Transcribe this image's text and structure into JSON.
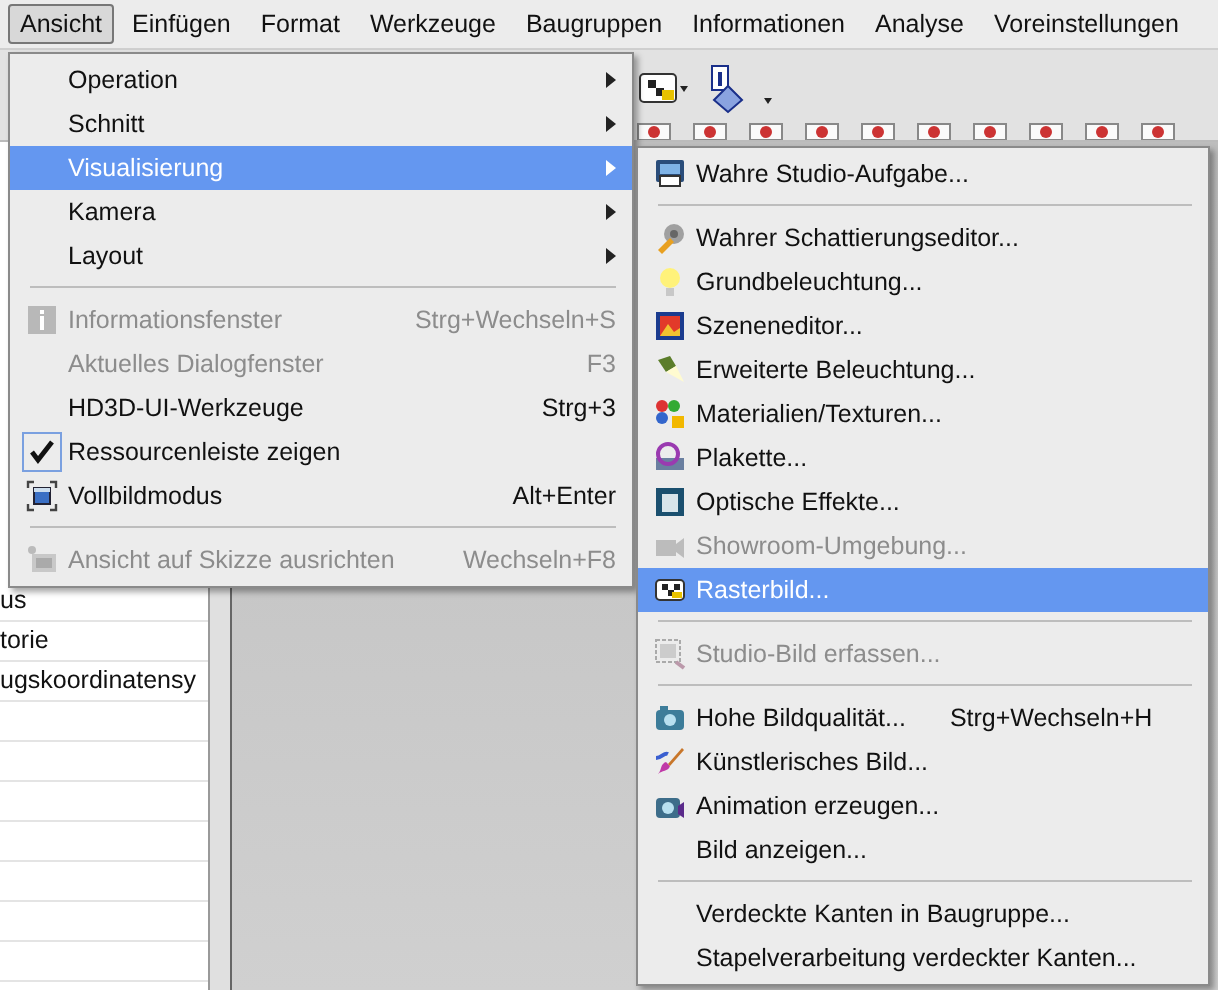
{
  "menubar": [
    {
      "label": "Ansicht",
      "selected": true
    },
    {
      "label": "Einfügen",
      "selected": false
    },
    {
      "label": "Format",
      "selected": false
    },
    {
      "label": "Werkzeuge",
      "selected": false
    },
    {
      "label": "Baugruppen",
      "selected": false
    },
    {
      "label": "Informationen",
      "selected": false
    },
    {
      "label": "Analyse",
      "selected": false
    },
    {
      "label": "Voreinstellungen",
      "selected": false
    }
  ],
  "view_menu": [
    {
      "kind": "submenu",
      "label": "Operation",
      "selected": false
    },
    {
      "kind": "submenu",
      "label": "Schnitt",
      "selected": false
    },
    {
      "kind": "submenu",
      "label": "Visualisierung",
      "selected": true
    },
    {
      "kind": "submenu",
      "label": "Kamera",
      "selected": false
    },
    {
      "kind": "submenu",
      "label": "Layout",
      "selected": false
    },
    {
      "kind": "separator"
    },
    {
      "kind": "command",
      "label": "Informationsfenster",
      "shortcut": "Strg+Wechseln+S",
      "disabled": true,
      "checked": false
    },
    {
      "kind": "command",
      "label": "Aktuelles Dialogfenster",
      "shortcut": "F3",
      "disabled": true,
      "checked": false
    },
    {
      "kind": "command",
      "label": "HD3D-UI-Werkzeuge",
      "shortcut": "Strg+3",
      "disabled": false,
      "checked": false
    },
    {
      "kind": "command",
      "label": "Ressourcenleiste zeigen",
      "disabled": false,
      "checked": true
    },
    {
      "kind": "command",
      "label": "Vollbildmodus",
      "shortcut": "Alt+Enter",
      "disabled": false,
      "checked": false
    },
    {
      "kind": "separator"
    },
    {
      "kind": "command",
      "label": "Ansicht auf Skizze ausrichten",
      "shortcut": "Wechseln+F8",
      "disabled": true,
      "checked": false
    }
  ],
  "visualization_submenu": [
    {
      "label": "Wahre Studio-Aufgabe...",
      "disabled": false,
      "selected": false
    },
    {
      "kind": "separator"
    },
    {
      "label": "Wahrer Schattierungseditor...",
      "disabled": false,
      "selected": false
    },
    {
      "label": "Grundbeleuchtung...",
      "disabled": false,
      "selected": false
    },
    {
      "label": "Szeneneditor...",
      "disabled": false,
      "selected": false
    },
    {
      "label": "Erweiterte Beleuchtung...",
      "disabled": false,
      "selected": false
    },
    {
      "label": "Materialien/Texturen...",
      "disabled": false,
      "selected": false
    },
    {
      "label": "Plakette...",
      "disabled": false,
      "selected": false
    },
    {
      "label": "Optische Effekte...",
      "disabled": false,
      "selected": false
    },
    {
      "label": "Showroom-Umgebung...",
      "disabled": true,
      "selected": false
    },
    {
      "label": "Rasterbild...",
      "disabled": false,
      "selected": true
    },
    {
      "kind": "separator"
    },
    {
      "label": "Studio-Bild erfassen...",
      "disabled": true,
      "selected": false
    },
    {
      "kind": "separator"
    },
    {
      "label": "Hohe Bildqualität...",
      "shortcut": "Strg+Wechseln+H",
      "disabled": false,
      "selected": false
    },
    {
      "label": "Künstlerisches Bild...",
      "disabled": false,
      "selected": false
    },
    {
      "label": "Animation erzeugen...",
      "disabled": false,
      "selected": false
    },
    {
      "label": "Bild anzeigen...",
      "disabled": false,
      "selected": false
    },
    {
      "kind": "separator"
    },
    {
      "label": "Verdeckte Kanten in Baugruppe...",
      "disabled": false,
      "selected": false
    },
    {
      "label": "Stapelverarbeitung verdeckter Kanten...",
      "disabled": false,
      "selected": false
    }
  ],
  "navigator_rows": [
    "us",
    "torie",
    "ugskoordinatensy"
  ]
}
